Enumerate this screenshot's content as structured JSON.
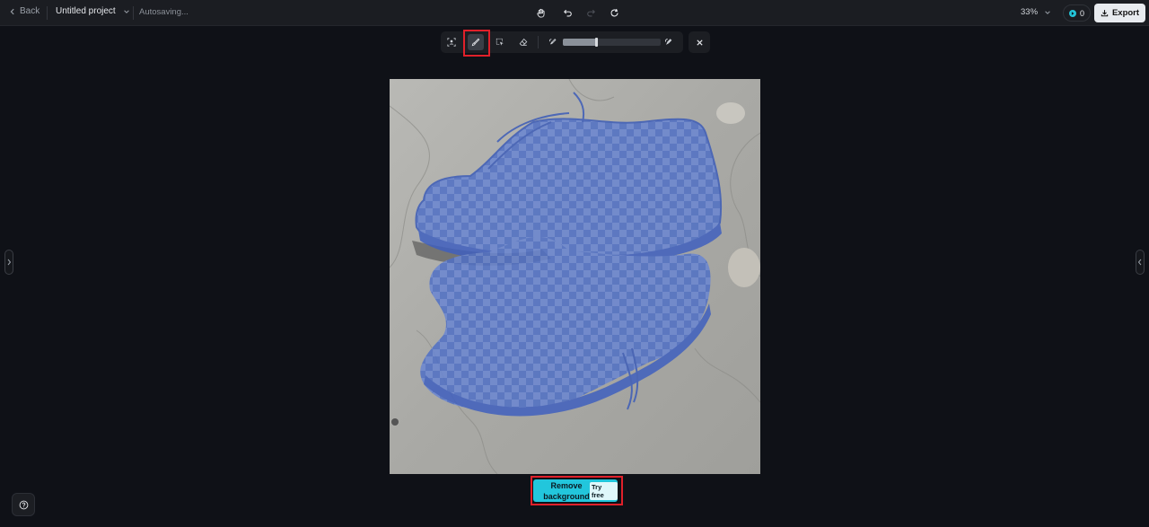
{
  "header": {
    "back_label": "Back",
    "project_title": "Untitled project",
    "status": "Autosaving...",
    "zoom": "33%",
    "credits": "0",
    "export_label": "Export"
  },
  "brush_toolbar": {
    "brush_size_percent": 34
  },
  "canvas": {
    "image": "sneakers on concrete with blue selection mask"
  },
  "actions": {
    "remove_background_label": "Remove background",
    "try_free_badge": "Try free"
  },
  "icons": {
    "back": "chevron-left-icon",
    "project_menu": "chevron-down-icon",
    "hand": "hand-icon",
    "undo": "undo-icon",
    "redo": "redo-icon",
    "refresh": "refresh-icon",
    "help": "help-icon"
  },
  "colors": {
    "accent": "#22c6dc",
    "highlight": "#e0202a",
    "mask": "#4a6fd6",
    "background": "#0f1117"
  }
}
